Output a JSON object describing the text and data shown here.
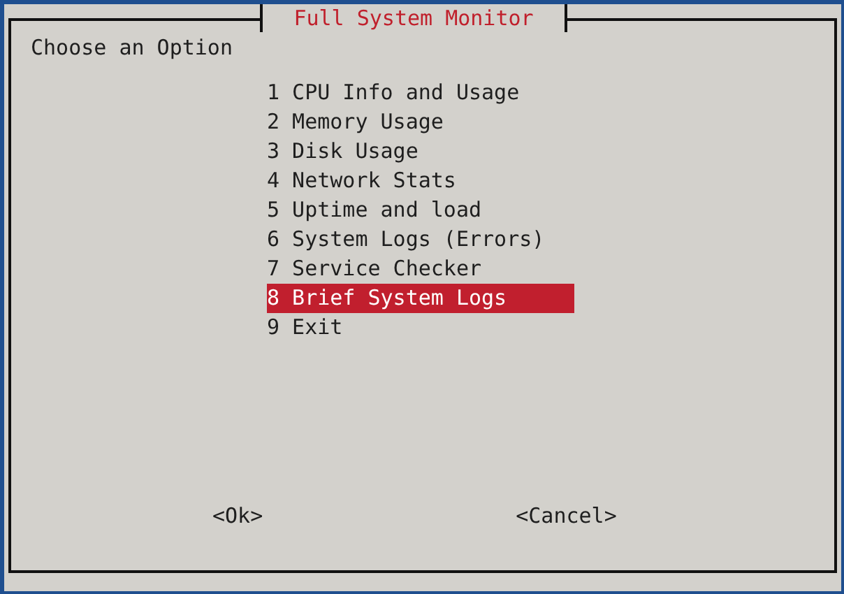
{
  "dialog": {
    "title": "Full System Monitor",
    "prompt": "Choose an Option"
  },
  "menu": [
    {
      "number": "1",
      "label": "CPU Info and Usage",
      "selected": false
    },
    {
      "number": "2",
      "label": "Memory Usage",
      "selected": false
    },
    {
      "number": "3",
      "label": "Disk Usage",
      "selected": false
    },
    {
      "number": "4",
      "label": "Network Stats",
      "selected": false
    },
    {
      "number": "5",
      "label": "Uptime and load",
      "selected": false
    },
    {
      "number": "6",
      "label": "System Logs (Errors)",
      "selected": false
    },
    {
      "number": "7",
      "label": "Service Checker",
      "selected": false
    },
    {
      "number": "8",
      "label": "Brief System Logs",
      "selected": true
    },
    {
      "number": "9",
      "label": "Exit",
      "selected": false
    }
  ],
  "buttons": [
    {
      "label": "<Ok>"
    },
    {
      "label": "<Cancel>"
    }
  ]
}
